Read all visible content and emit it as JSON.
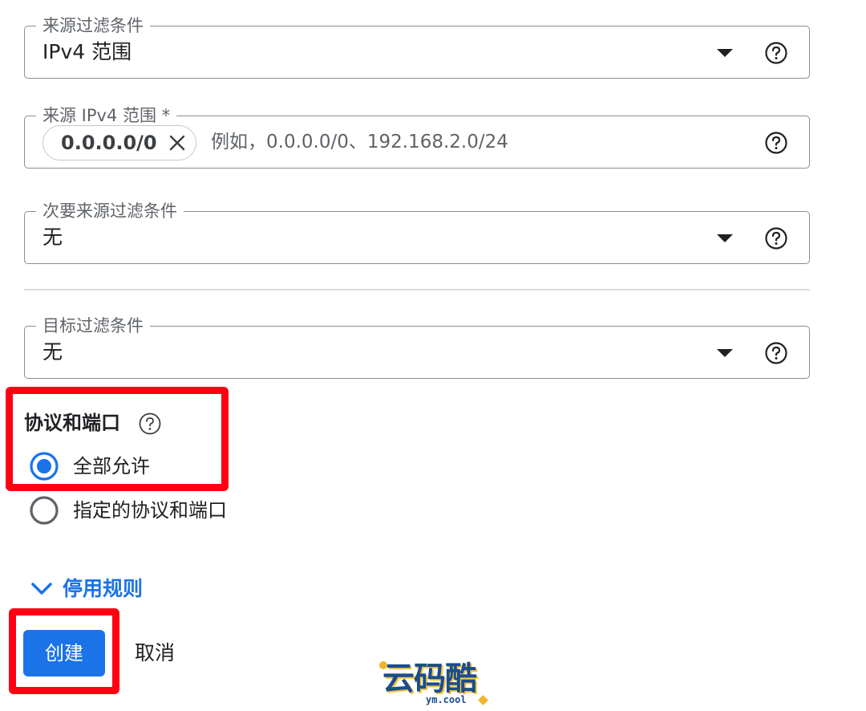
{
  "fields": {
    "source_filter": {
      "legend": "来源过滤条件",
      "value": "IPv4 范围"
    },
    "source_ip_range": {
      "legend": "来源 IPv4 范围 *",
      "chip": "0.0.0.0/0",
      "placeholder": "例如，0.0.0.0/0、192.168.2.0/24"
    },
    "secondary_source_filter": {
      "legend": "次要来源过滤条件",
      "value": "无"
    },
    "target_filter": {
      "legend": "目标过滤条件",
      "value": "无"
    }
  },
  "protocols": {
    "title": "协议和端口",
    "options": [
      {
        "label": "全部允许",
        "selected": true
      },
      {
        "label": "指定的协议和端口",
        "selected": false
      }
    ]
  },
  "toggle": {
    "label": "停用规则"
  },
  "actions": {
    "create_label": "创建",
    "cancel_label": "取消"
  },
  "watermark": {
    "logo_text": "云码酷",
    "sub_text": "ym.cool"
  },
  "colors": {
    "accent": "#1a73e8",
    "highlight": "#ff0013",
    "outline": "#8a8d91",
    "text": "#202124",
    "muted": "#5f6368"
  },
  "icons": {
    "dropdown": "caret-down-icon",
    "help": "help-circle-icon",
    "chip_remove": "close-icon",
    "toggle": "chevron-down-icon"
  }
}
